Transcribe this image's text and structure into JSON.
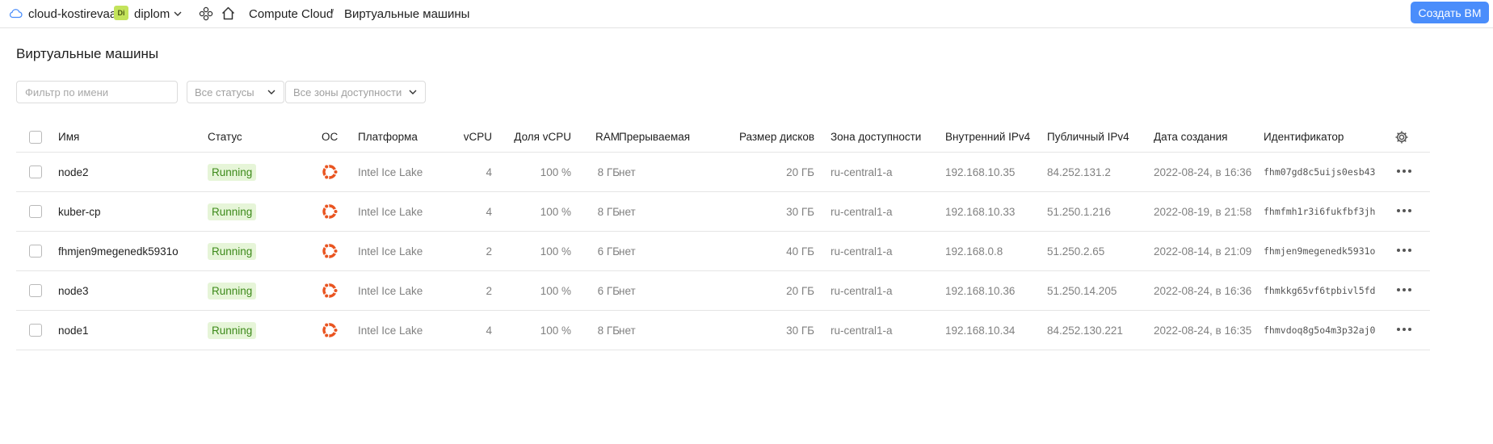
{
  "topbar": {
    "cloud_name": "cloud-kostirevaa",
    "folder_badge": "Di",
    "folder_name": "diplom",
    "breadcrumb_service": "Compute Cloud",
    "breadcrumb_separator": "/",
    "breadcrumb_page": "Виртуальные машины",
    "create_button": "Создать ВМ",
    "accent_color": "#4a8dfb"
  },
  "page": {
    "title": "Виртуальные машины",
    "filter_placeholder": "Фильтр по имени",
    "status_select": "Все статусы",
    "zone_select": "Все зоны доступности"
  },
  "table": {
    "headers": {
      "name": "Имя",
      "status": "Статус",
      "os": "ОС",
      "platform": "Платформа",
      "vcpu": "vCPU",
      "vcpu_share": "Доля vCPU",
      "ram": "RAM",
      "preemptible": "Прерываемая",
      "disk_size": "Размер дисков",
      "zone": "Зона доступности",
      "internal_ip": "Внутренний IPv4",
      "public_ip": "Публичный IPv4",
      "created": "Дата создания",
      "id": "Идентификатор"
    },
    "rows": [
      {
        "name": "node2",
        "status": "Running",
        "os": "ubuntu-icon",
        "platform": "Intel Ice Lake",
        "vcpu": "4",
        "vcpu_share": "100 %",
        "ram": "8 ГБ",
        "preemptible": "нет",
        "disk_size": "20 ГБ",
        "zone": "ru-central1-a",
        "internal_ip": "192.168.10.35",
        "public_ip": "84.252.131.2",
        "created": "2022-08-24, в 16:36",
        "id": "fhm07gd8c5uijs0esb43"
      },
      {
        "name": "kuber-cp",
        "status": "Running",
        "os": "ubuntu-icon",
        "platform": "Intel Ice Lake",
        "vcpu": "4",
        "vcpu_share": "100 %",
        "ram": "8 ГБ",
        "preemptible": "нет",
        "disk_size": "30 ГБ",
        "zone": "ru-central1-a",
        "internal_ip": "192.168.10.33",
        "public_ip": "51.250.1.216",
        "created": "2022-08-19, в 21:58",
        "id": "fhmfmh1r3i6fukfbf3jh"
      },
      {
        "name": "fhmjen9megenedk5931o",
        "status": "Running",
        "os": "ubuntu-icon",
        "platform": "Intel Ice Lake",
        "vcpu": "2",
        "vcpu_share": "100 %",
        "ram": "6 ГБ",
        "preemptible": "нет",
        "disk_size": "40 ГБ",
        "zone": "ru-central1-a",
        "internal_ip": "192.168.0.8",
        "public_ip": "51.250.2.65",
        "created": "2022-08-14, в 21:09",
        "id": "fhmjen9megenedk5931o"
      },
      {
        "name": "node3",
        "status": "Running",
        "os": "ubuntu-icon",
        "platform": "Intel Ice Lake",
        "vcpu": "2",
        "vcpu_share": "100 %",
        "ram": "6 ГБ",
        "preemptible": "нет",
        "disk_size": "20 ГБ",
        "zone": "ru-central1-a",
        "internal_ip": "192.168.10.36",
        "public_ip": "51.250.14.205",
        "created": "2022-08-24, в 16:36",
        "id": "fhmkkg65vf6tpbivl5fd"
      },
      {
        "name": "node1",
        "status": "Running",
        "os": "ubuntu-icon",
        "platform": "Intel Ice Lake",
        "vcpu": "4",
        "vcpu_share": "100 %",
        "ram": "8 ГБ",
        "preemptible": "нет",
        "disk_size": "30 ГБ",
        "zone": "ru-central1-a",
        "internal_ip": "192.168.10.34",
        "public_ip": "84.252.130.221",
        "created": "2022-08-24, в 16:35",
        "id": "fhmvdoq8g5o4m3p32aj0"
      }
    ]
  }
}
